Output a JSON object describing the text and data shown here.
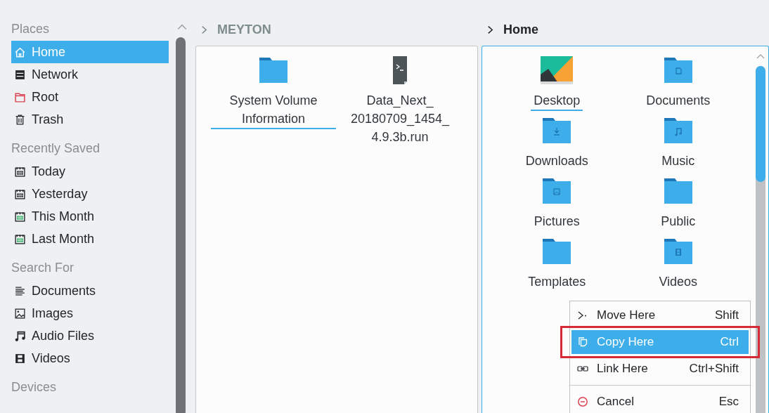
{
  "sidebar": {
    "sections": [
      {
        "title": "Places",
        "items": [
          {
            "label": "Home",
            "selected": true
          },
          {
            "label": "Network",
            "selected": false
          },
          {
            "label": "Root",
            "selected": false
          },
          {
            "label": "Trash",
            "selected": false
          }
        ]
      },
      {
        "title": "Recently Saved",
        "items": [
          {
            "label": "Today",
            "selected": false
          },
          {
            "label": "Yesterday",
            "selected": false
          },
          {
            "label": "This Month",
            "selected": false
          },
          {
            "label": "Last Month",
            "selected": false
          }
        ]
      },
      {
        "title": "Search For",
        "items": [
          {
            "label": "Documents",
            "selected": false
          },
          {
            "label": "Images",
            "selected": false
          },
          {
            "label": "Audio Files",
            "selected": false
          },
          {
            "label": "Videos",
            "selected": false
          }
        ]
      },
      {
        "title": "Devices"
      }
    ]
  },
  "panes": [
    {
      "path": "MEYTON",
      "active": false,
      "items": [
        {
          "name": "System Volume Information",
          "selected": true
        },
        {
          "name": "Data_Next_ 20180709_1454_ 4.9.3b.run",
          "selected": false
        }
      ]
    },
    {
      "path": "Home",
      "active": true,
      "items": [
        {
          "name": "Desktop",
          "selected": true
        },
        {
          "name": "Documents",
          "selected": false
        },
        {
          "name": "Downloads",
          "selected": false
        },
        {
          "name": "Music",
          "selected": false
        },
        {
          "name": "Pictures",
          "selected": false
        },
        {
          "name": "Public",
          "selected": false
        },
        {
          "name": "Templates",
          "selected": false
        },
        {
          "name": "Videos",
          "selected": false
        }
      ]
    }
  ],
  "drop_menu": {
    "items": [
      {
        "label": "Move Here",
        "shortcut": "Shift",
        "selected": false,
        "annotated": false
      },
      {
        "label": "Copy Here",
        "shortcut": "Ctrl",
        "selected": true,
        "annotated": true
      },
      {
        "label": "Link Here",
        "shortcut": "Ctrl+Shift",
        "selected": false,
        "annotated": false
      },
      {
        "label": "Cancel",
        "shortcut": "Esc",
        "selected": false,
        "annotated": false
      }
    ]
  }
}
